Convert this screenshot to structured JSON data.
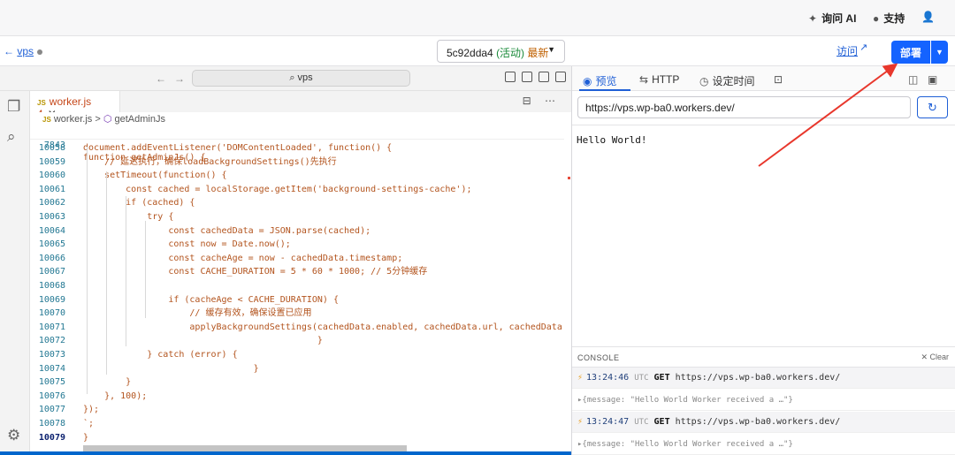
{
  "topbar": {
    "ai_label": "询问 AI",
    "support_label": "支持"
  },
  "toolbar": {
    "back_text": "← ",
    "back_link": "vps",
    "version_hash": "5c92dda4",
    "version_status": "(活动)",
    "version_latest": "最新",
    "visit_label": "访问",
    "deploy_label": "部署"
  },
  "editor": {
    "search_text": "⌕ vps",
    "tab_icon": "JS",
    "tab_label": "worker.js 4",
    "crumb_file": "worker.js",
    "crumb_sep": ">",
    "crumb_fn": "getAdminJs",
    "sticky_line_no": "7843",
    "sticky_line": "function getAdminJs() {",
    "lines": [
      {
        "no": "10058",
        "text": "document.addEventListener('DOMContentLoaded', function() {"
      },
      {
        "no": "10059",
        "text": "    // 延迟执行，确保loadBackgroundSettings()先执行"
      },
      {
        "no": "10060",
        "text": "    setTimeout(function() {"
      },
      {
        "no": "10061",
        "text": "        const cached = localStorage.getItem('background-settings-cache');"
      },
      {
        "no": "10062",
        "text": "        if (cached) {"
      },
      {
        "no": "10063",
        "text": "            try {"
      },
      {
        "no": "10064",
        "text": "                const cachedData = JSON.parse(cached);"
      },
      {
        "no": "10065",
        "text": "                const now = Date.now();"
      },
      {
        "no": "10066",
        "text": "                const cacheAge = now - cachedData.timestamp;"
      },
      {
        "no": "10067",
        "text": "                const CACHE_DURATION = 5 * 60 * 1000; // 5分钟缓存"
      },
      {
        "no": "10068",
        "text": ""
      },
      {
        "no": "10069",
        "text": "                if (cacheAge < CACHE_DURATION) {"
      },
      {
        "no": "10070",
        "text": "                    // 缓存有效，确保设置已应用"
      },
      {
        "no": "10071",
        "text": "                    applyBackgroundSettings(cachedData.enabled, cachedData.url, cachedData.opacity,"
      },
      {
        "no": "10072",
        "text": "                                            }"
      },
      {
        "no": "10073",
        "text": "            } catch (error) {"
      },
      {
        "no": "10074",
        "text": "                                }"
      },
      {
        "no": "10075",
        "text": "        }"
      },
      {
        "no": "10076",
        "text": "    }, 100);"
      },
      {
        "no": "10077",
        "text": "});"
      },
      {
        "no": "10078",
        "text": "`;"
      },
      {
        "no": "10079",
        "text": "}"
      }
    ]
  },
  "preview": {
    "tab_preview": "预览",
    "tab_http": "HTTP",
    "tab_schedule": "设定时间",
    "url": "https://vps.wp-ba0.workers.dev/",
    "body_text": "Hello World!"
  },
  "console": {
    "title": "CONSOLE",
    "clear_label": "Clear",
    "logs": [
      {
        "time": "13:24:46",
        "tz": "UTC",
        "method": "GET",
        "url": "https://vps.wp-ba0.workers.dev/",
        "msg": "▸{message: \"Hello World Worker received a …\"}"
      },
      {
        "time": "13:24:47",
        "tz": "UTC",
        "method": "GET",
        "url": "https://vps.wp-ba0.workers.dev/",
        "msg": "▸{message: \"Hello World Worker received a …\"}"
      }
    ]
  },
  "colors": {
    "accent": "#1463ff",
    "annotation_arrow": "#e8372c"
  }
}
